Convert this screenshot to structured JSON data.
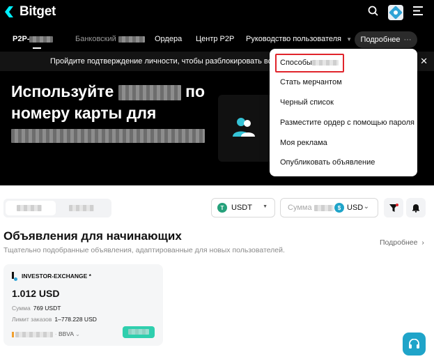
{
  "header": {
    "logo_text": "Bitget",
    "icons": [
      "search-icon",
      "avatar",
      "menu-icon"
    ]
  },
  "nav": {
    "items": [
      {
        "label": "P2P-",
        "has_blurred": true
      },
      {
        "label": "Банковский",
        "has_blurred": true
      },
      {
        "label": "Ордера"
      },
      {
        "label": "Центр P2P"
      },
      {
        "label": "Руководство пользователя"
      }
    ],
    "more_label": "Подробнее"
  },
  "banner": {
    "text": "Пройдите подтверждение личности, чтобы разблокировать все фу"
  },
  "hero": {
    "title_line1_start": "Используйте",
    "title_line1_end": "по",
    "title_line2": "номеру карты для"
  },
  "dropdown": {
    "items": [
      {
        "label": "Способы",
        "has_blurred": true
      },
      {
        "label": "Стать мерчантом"
      },
      {
        "label": "Черный список"
      },
      {
        "label": "Разместите ордер с помощью пароля"
      },
      {
        "label": "Моя реклама"
      },
      {
        "label": "Опубликовать объявление"
      }
    ]
  },
  "filters": {
    "coin": "USDT",
    "amount_placeholder": "Сумма",
    "currency": "USD"
  },
  "section": {
    "title": "Объявления для начинающих",
    "subtitle": "Тщательно подобранные объявления, адаптированные для новых пользователей.",
    "more": "Подробнее"
  },
  "ad": {
    "merchant": "INVESTOR-EXCHANGE *",
    "price": "1.012 USD",
    "amount_label": "Сумма",
    "amount_value": "769 USDT",
    "limit_label": "Лимит заказов",
    "limit_value": "1–778.228 USD",
    "payment": "BBVA"
  },
  "colors": {
    "brand": "#00f0ff",
    "accent_green": "#2fcfae",
    "highlight_red": "#e0242b",
    "support_blue": "#1fa4c9"
  }
}
